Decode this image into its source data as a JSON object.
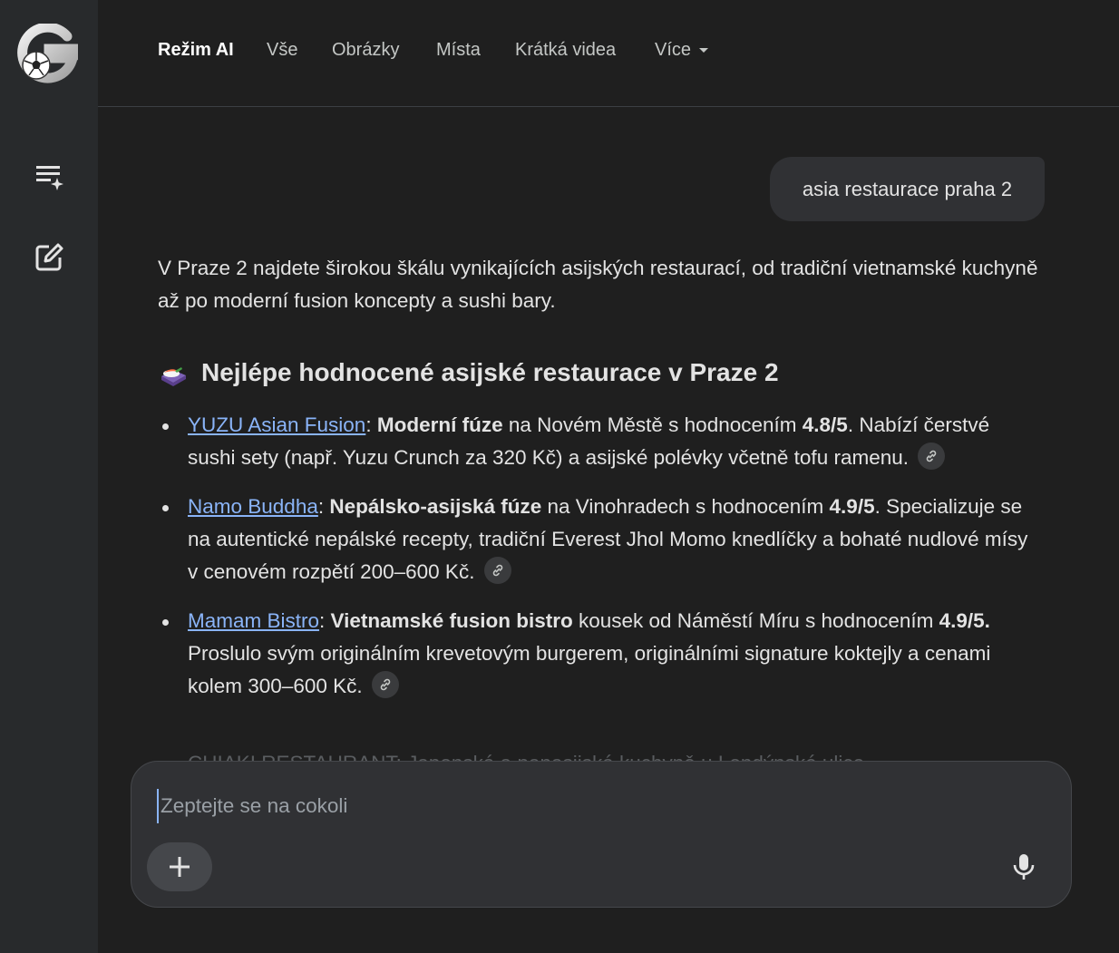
{
  "nav": {
    "tabs": [
      {
        "label": "Režim AI",
        "active": true
      },
      {
        "label": "Vše"
      },
      {
        "label": "Obrázky"
      },
      {
        "label": "Místa"
      },
      {
        "label": "Krátká videa"
      },
      {
        "label": "Více"
      }
    ]
  },
  "sidebar": {
    "icons": [
      "logo-icon",
      "history-sparkle-icon",
      "new-chat-icon"
    ]
  },
  "query": {
    "text": "asia restaurace praha 2"
  },
  "answer": {
    "intro": "V Praze 2 najdete širokou škálu vynikajících asijských restaurací, od tradiční vietnamské kuchyně až po moderní fusion koncepty a sushi bary.",
    "heading": "Nejlépe hodnocené asijské restaurace v Praze 2",
    "heading_icon": "sushi-emoji-icon",
    "items": [
      {
        "name": "YUZU Asian Fusion",
        "sep": ": ",
        "bold1": "Moderní fúze",
        "text1": " na Novém Městě s hodnocením ",
        "bold2": "4.8/5",
        "text2": ". Nabízí čerstvé sushi sety (např. Yuzu Crunch za 320 Kč) a asijské polévky včetně tofu ramenu."
      },
      {
        "name": "Namo Buddha",
        "sep": ": ",
        "bold1": "Nepálsko-asijská fúze",
        "text1": " na Vinohradech s hodnocením ",
        "bold2": "4.9/5",
        "text2": ". Specializuje se na autentické nepálské recepty, tradiční Everest Jhol Momo knedlíčky a bohaté nudlové mísy v cenovém rozpětí 200–600 Kč."
      },
      {
        "name": "Mamam Bistro",
        "sep": ": ",
        "bold1": "Vietnamské fusion bistro",
        "text1": " kousek od Náměstí Míru s hodnocením ",
        "bold2": "4.9/5.",
        "text2": " Proslulo svým originálním krevetovým burgerem, originálními signature koktejly a cenami kolem 300–600 Kč."
      }
    ],
    "faded_next": "CHIAKI RESTAURANT: Japonská a panasijská kuchyně u Londýnské ulice"
  },
  "composer": {
    "placeholder": "Zeptejte se na cokoli",
    "value": ""
  },
  "colors": {
    "background": "#1f1f1f",
    "sidebar": "#282a2c",
    "link": "#8ab4f8",
    "bubble": "#303134",
    "text": "#e3e3e3"
  }
}
